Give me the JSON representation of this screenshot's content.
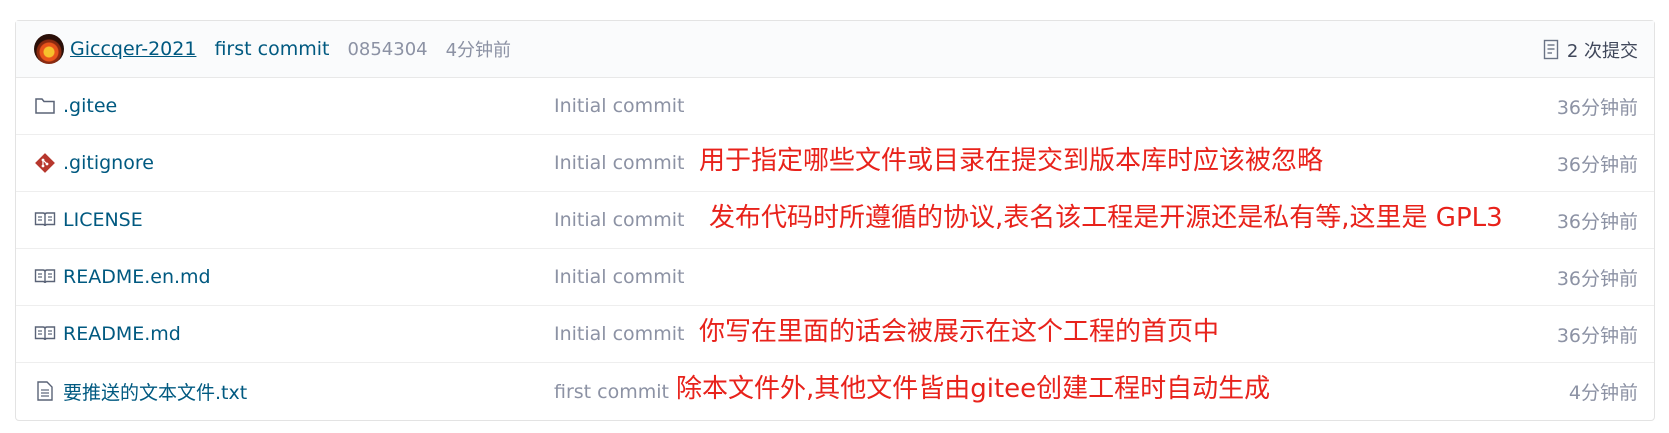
{
  "header": {
    "user": "Giccqer-2021",
    "message": "first commit",
    "sha": "0854304",
    "time": "4分钟前",
    "commits": "2 次提交"
  },
  "files": [
    {
      "name": ".gitee",
      "commit": "Initial commit",
      "time": "36分钟前",
      "note": "",
      "icon": "folder-icon"
    },
    {
      "name": ".gitignore",
      "commit": "Initial commit",
      "time": "36分钟前",
      "note": "用于指定哪些文件或目录在提交到版本库时应该被忽略",
      "icon": "git-icon"
    },
    {
      "name": "LICENSE",
      "commit": "Initial commit",
      "time": "36分钟前",
      "note": "发布代码时所遵循的协议,表名该工程是开源还是私有等,这里是 GPL3",
      "icon": "book-icon"
    },
    {
      "name": "README.en.md",
      "commit": "Initial commit",
      "time": "36分钟前",
      "note": "",
      "icon": "book-icon"
    },
    {
      "name": "README.md",
      "commit": "Initial commit",
      "time": "36分钟前",
      "note": "你写在里面的话会被展示在这个工程的首页中",
      "icon": "book-icon"
    },
    {
      "name": "要推送的文本文件.txt",
      "commit": "first commit",
      "time": "4分钟前",
      "note": "除本文件外,其他文件皆由gitee创建工程时自动生成",
      "icon": "file-icon"
    }
  ],
  "colors": {
    "link": "#005980",
    "muted": "#8c92a4",
    "annotation": "#e8221b"
  }
}
